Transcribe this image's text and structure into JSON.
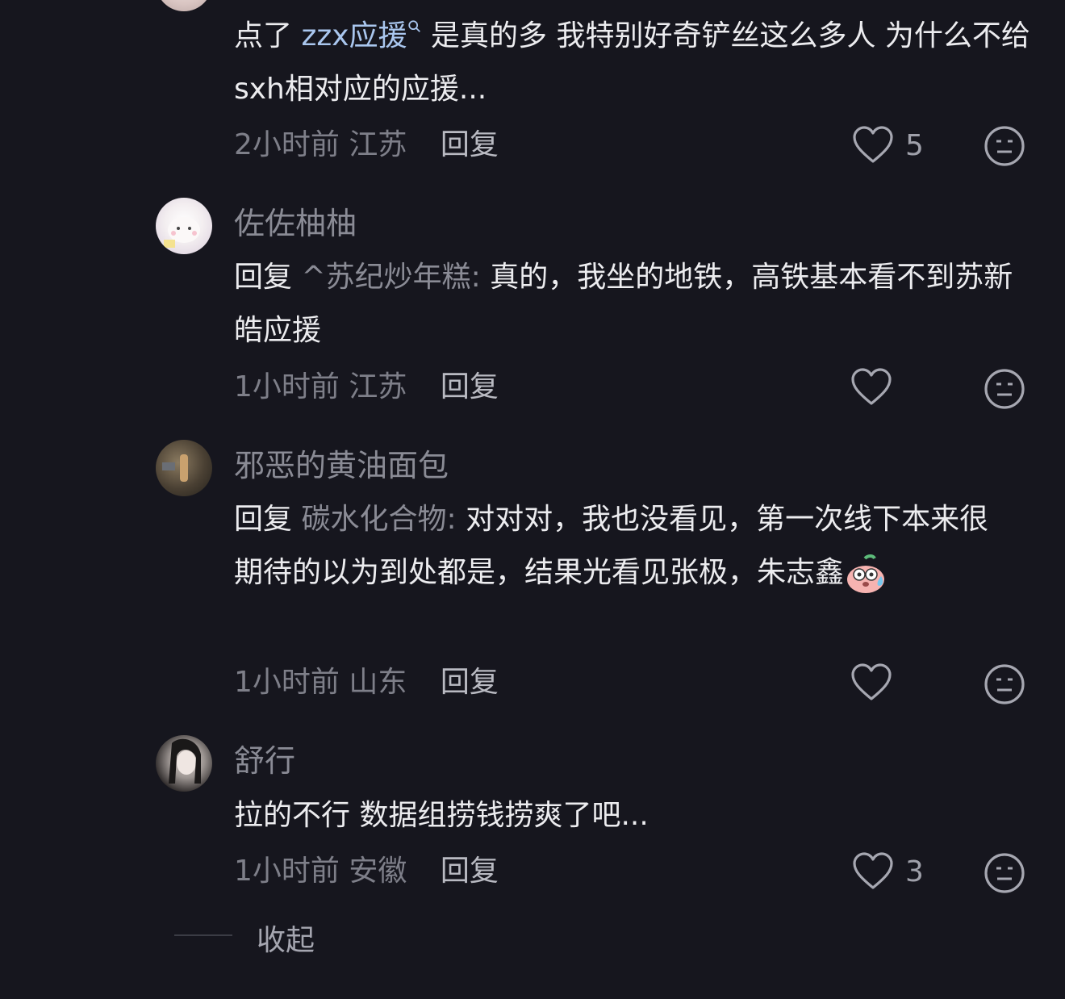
{
  "colors": {
    "background": "#16161e",
    "text": "#ececef",
    "muted": "#7e7f89",
    "link": "#a9c6ee"
  },
  "comment0": {
    "text_prefix": "点了",
    "link_text": "zzx应援",
    "link_icon": "search-icon",
    "text_suffix": "是真的多 我特别好奇铲丝这么多人 为什么不给sxh相对应的应援...",
    "time": "2小时前",
    "location": "江苏",
    "reply_label": "回复",
    "likes": "5"
  },
  "comment1": {
    "username": "佐佐柚柚",
    "reply_prefix": "回复",
    "reply_to": "^苏纪炒年糕:",
    "text": "真的，我坐的地铁，高铁基本看不到苏新皓应援",
    "time": "1小时前",
    "location": "江苏",
    "reply_label": "回复",
    "likes": ""
  },
  "comment2": {
    "username": "邪恶的黄油面包",
    "reply_prefix": "回复",
    "reply_to": "碳水化合物:",
    "text": "对对对，我也没看见，第一次线下本来很期待的以为到处都是，结果光看见张极，朱志鑫",
    "emoji": "sweating-blob-emoji",
    "time": "1小时前",
    "location": "山东",
    "reply_label": "回复",
    "likes": ""
  },
  "comment3": {
    "username": "舒行",
    "text": "拉的不行 数据组捞钱捞爽了吧...",
    "time": "1小时前",
    "location": "安徽",
    "reply_label": "回复",
    "likes": "3"
  },
  "collapse_label": "收起"
}
